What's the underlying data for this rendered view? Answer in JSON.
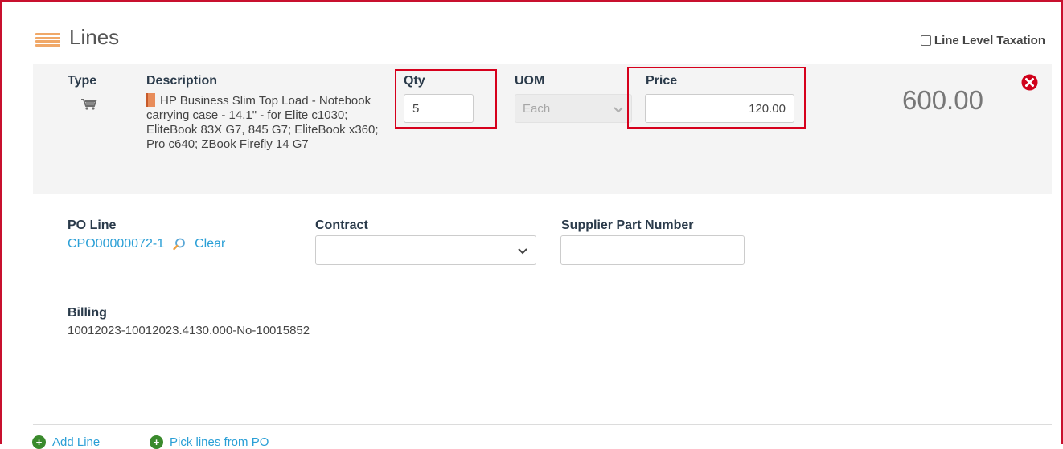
{
  "header": {
    "title": "Lines",
    "line_level_taxation": "Line Level Taxation",
    "line_level_taxation_checked": false
  },
  "line_item": {
    "type_label": "Type",
    "type_icon": "shopping-cart-icon",
    "description_label": "Description",
    "description": "HP Business Slim Top Load - Notebook carrying case - 14.1\" - for Elite c1030; EliteBook 83X G7, 845 G7; EliteBook x360; Pro c640; ZBook Firefly 14 G7",
    "qty_label": "Qty",
    "qty": "5",
    "uom_label": "UOM",
    "uom": "Each",
    "price_label": "Price",
    "price": "120.00",
    "total": "600.00"
  },
  "details": {
    "po_line_label": "PO Line",
    "po_line_value": "CPO00000072-1",
    "clear_label": "Clear",
    "contract_label": "Contract",
    "contract_value": "",
    "supplier_part_label": "Supplier Part Number",
    "supplier_part_value": "",
    "billing_label": "Billing",
    "billing_value": "10012023-10012023.4130.000-No-10015852"
  },
  "footer": {
    "add_line": "Add Line",
    "pick_lines": "Pick lines from PO"
  },
  "colors": {
    "highlight": "#d6001c",
    "link": "#2a9fd6",
    "accent_orange": "#f0a868"
  }
}
